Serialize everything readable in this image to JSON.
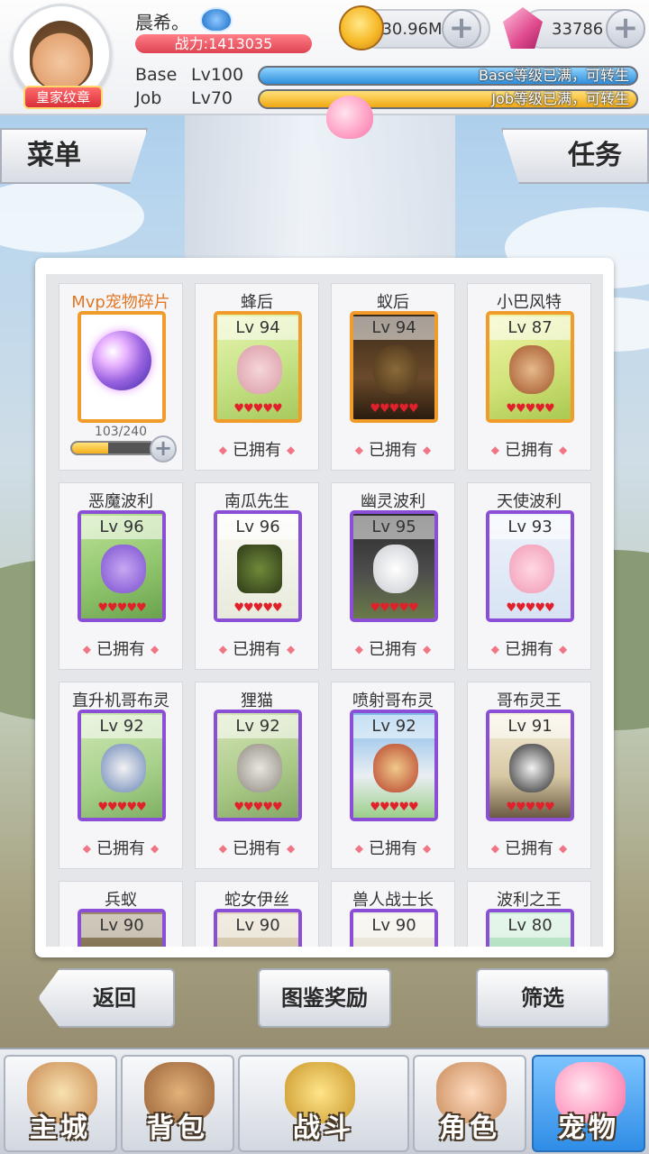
{
  "player": {
    "name": "晨希。",
    "badge": "皇家纹章",
    "power": "战力:1413035",
    "base_label": "Base",
    "base_level": "Lv100",
    "base_status": "Base等级已满，可转生",
    "base_progress": 1.0,
    "job_label": "Job",
    "job_level": "Lv70",
    "job_status": "Job等级已满，可转生",
    "job_progress": 1.0
  },
  "currency": {
    "zeny": "130.96M",
    "gems": "33786",
    "plus": "+"
  },
  "tabs": {
    "menu": "菜单",
    "task": "任务"
  },
  "fragment_card": {
    "title": "Mvp宠物碎片",
    "count": "103/240",
    "progress": 0.43,
    "plus": "+"
  },
  "owned_label": "已拥有",
  "diamond": "◆",
  "hearts": "♥♥♥♥♥",
  "pets": [
    {
      "name": "蜂后",
      "level": "Lv 94",
      "rarity": "orange"
    },
    {
      "name": "蚁后",
      "level": "Lv 94",
      "rarity": "orange"
    },
    {
      "name": "小巴风特",
      "level": "Lv 87",
      "rarity": "orange"
    },
    {
      "name": "恶魔波利",
      "level": "Lv 96",
      "rarity": "purple"
    },
    {
      "name": "南瓜先生",
      "level": "Lv 96",
      "rarity": "purple"
    },
    {
      "name": "幽灵波利",
      "level": "Lv 95",
      "rarity": "purple"
    },
    {
      "name": "天使波利",
      "level": "Lv 93",
      "rarity": "purple"
    },
    {
      "name": "直升机哥布灵",
      "level": "Lv 92",
      "rarity": "purple"
    },
    {
      "name": "狸猫",
      "level": "Lv 92",
      "rarity": "purple"
    },
    {
      "name": "喷射哥布灵",
      "level": "Lv 92",
      "rarity": "purple"
    },
    {
      "name": "哥布灵王",
      "level": "Lv 91",
      "rarity": "purple"
    },
    {
      "name": "兵蚁",
      "level": "Lv 90",
      "rarity": "purple"
    },
    {
      "name": "蛇女伊丝",
      "level": "Lv 90",
      "rarity": "purple"
    },
    {
      "name": "兽人战士长",
      "level": "Lv 90",
      "rarity": "purple"
    },
    {
      "name": "波利之王",
      "level": "Lv 80",
      "rarity": "purple"
    }
  ],
  "buttons": {
    "back": "返回",
    "rewards": "图鉴奖励",
    "filter": "筛选"
  },
  "nav": [
    {
      "label": "主城",
      "icon": "castle-icon"
    },
    {
      "label": "背包",
      "icon": "backpack-icon"
    },
    {
      "label": "战斗",
      "icon": "crossed-swords-icon"
    },
    {
      "label": "角色",
      "icon": "character-icon"
    },
    {
      "label": "宠物",
      "icon": "poring-pet-icon",
      "active": true
    }
  ],
  "colors": {
    "accent_orange": "#f09b2a",
    "accent_purple": "#8a4fd6",
    "power_red": "#e04352",
    "base_bar": "#3fa6e8",
    "job_bar": "#f5b820",
    "nav_active": "#2f8de6"
  }
}
